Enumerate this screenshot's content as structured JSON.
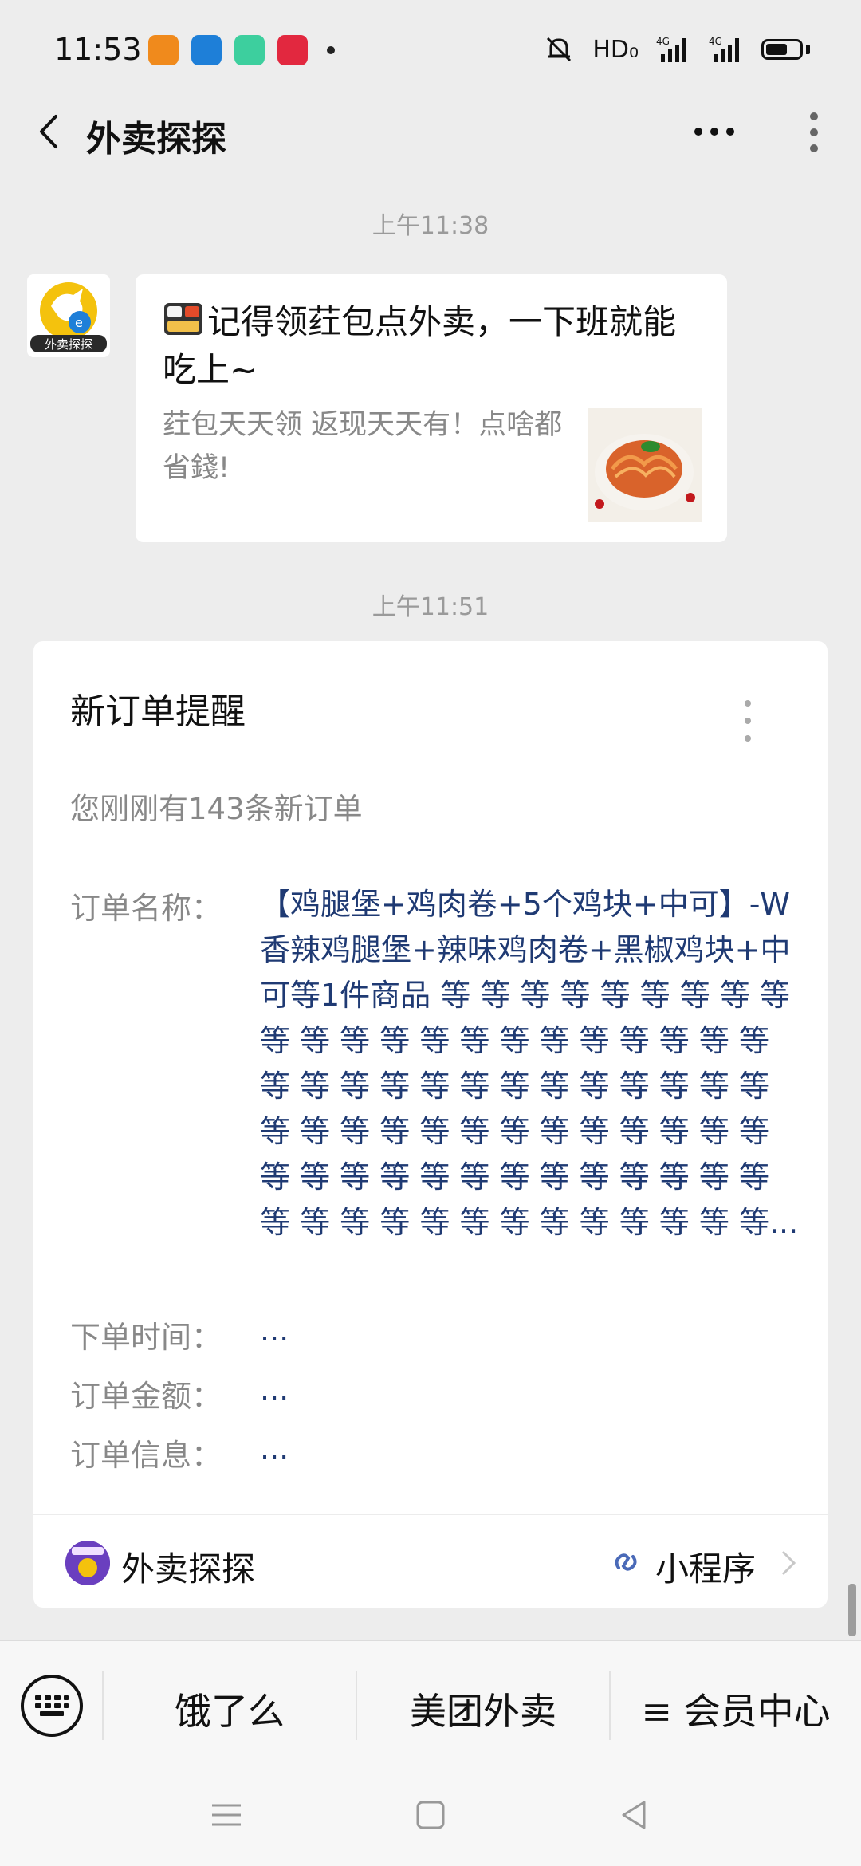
{
  "status_bar": {
    "time": "11:53",
    "network_label": "HD₀",
    "signal_1": "4G",
    "signal_2": "4G"
  },
  "title_bar": {
    "title": "外卖探探"
  },
  "messages": [
    {
      "timestamp": "上午11:38",
      "sender_logo_text": "外卖探探",
      "title": "记得领荭包点外卖，一下班就能吃上~",
      "description": "荭包天天领 返现天天有！点啥都省錢!"
    },
    {
      "timestamp": "上午11:51",
      "card": {
        "title": "新订单提醒",
        "subtitle": "您刚刚有143条新订单",
        "fields": [
          {
            "label": "订单名称：",
            "value": "【鸡腿堡+鸡肉卷+5个鸡块+中可】-W香辣鸡腿堡+辣味鸡肉卷+黑椒鸡块+中可等1件商品 等 等 等 等 等 等 等 等 等 等 等 等 等 等 等 等 等 等 等 等 等 等 等 等 等 等 等 等 等 等 等 等 等 等 等 等 等 等 等 等 等 等 等 等 等 等 等 等 等 等 等 等 等 等 等 等 等 等 等 等 等 等 等 等 等 等 等 等 等 等 等 等 等 等..."
          },
          {
            "label": "下单时间：",
            "value": "..."
          },
          {
            "label": "订单金额：",
            "value": "..."
          },
          {
            "label": "订单信息：",
            "value": "..."
          }
        ],
        "footer_name": "外卖探探",
        "footer_label": "小程序"
      }
    }
  ],
  "bottom_menu": {
    "items": [
      "饿了么",
      "美团外卖",
      "≡ 会员中心"
    ]
  },
  "colors": {
    "background": "#ededed",
    "link_blue": "#1f3a73",
    "muted": "#888888"
  }
}
